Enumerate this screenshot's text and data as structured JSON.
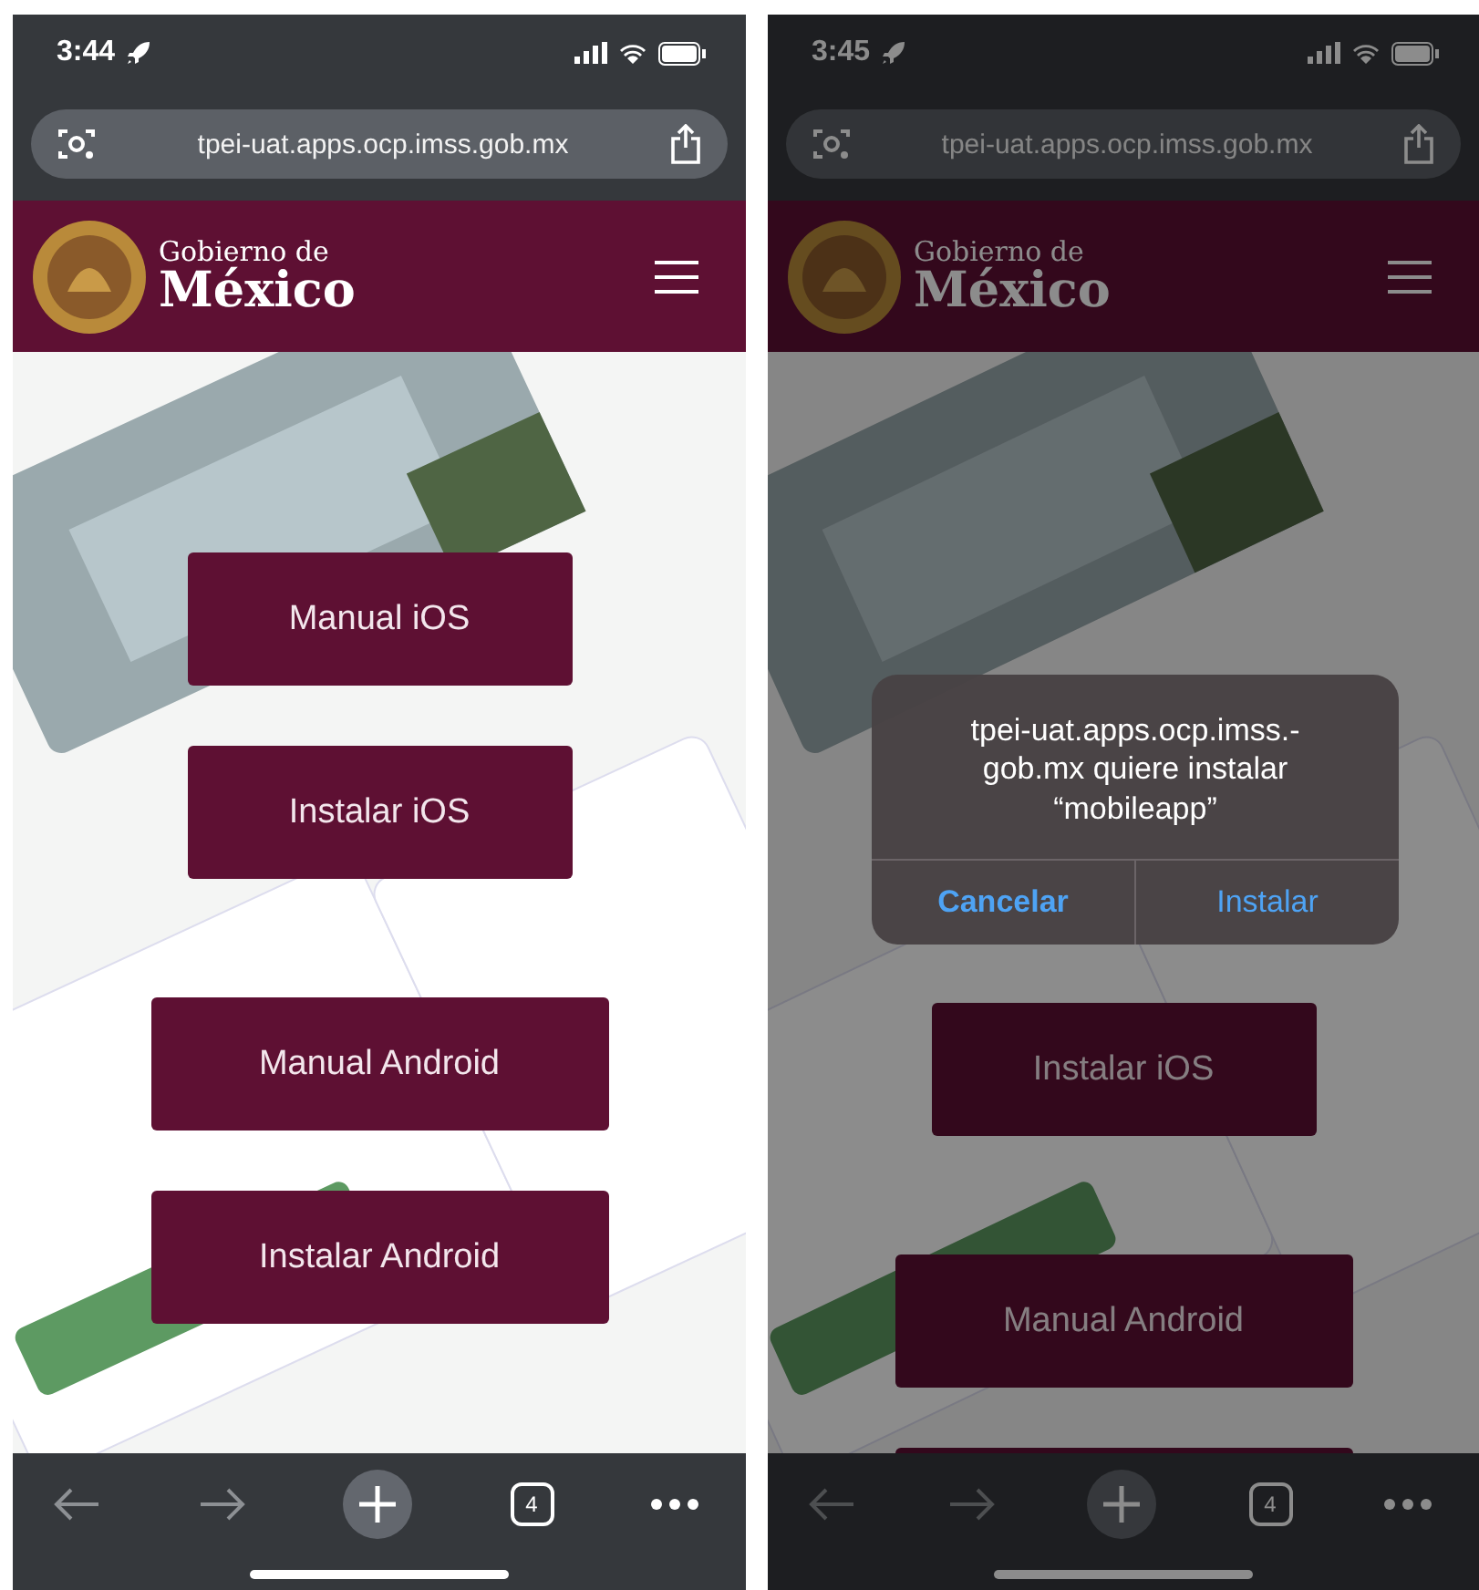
{
  "phones": [
    {
      "dimmed": false,
      "status_bar": {
        "time": "3:44"
      },
      "address_bar": {
        "url": "tpei-uat.apps.ocp.imss.gob.mx"
      },
      "header": {
        "line1": "Gobierno de",
        "line2": "México"
      },
      "buttons": [
        {
          "kind": "narrow",
          "label": "Manual iOS"
        },
        {
          "kind": "narrow",
          "label": "Instalar iOS"
        },
        {
          "kind": "wide",
          "label": "Manual Android"
        },
        {
          "kind": "wide",
          "label": "Instalar Android"
        }
      ],
      "toolbar": {
        "tab_count": "4"
      }
    },
    {
      "dimmed": true,
      "status_bar": {
        "time": "3:45"
      },
      "address_bar": {
        "url": "tpei-uat.apps.ocp.imss.gob.mx"
      },
      "header": {
        "line1": "Gobierno de",
        "line2": "México"
      },
      "buttons": [
        {
          "kind": "narrow",
          "label": "Instalar iOS"
        },
        {
          "kind": "wide",
          "label": "Manual Android"
        },
        {
          "kind": "cut"
        }
      ],
      "dialog": {
        "message": "tpei-uat.apps.ocp.imss.-gob.mx quiere instalar “mobileapp”",
        "actions": [
          {
            "label": "Cancelar",
            "bold": true
          },
          {
            "label": "Instalar",
            "bold": false
          }
        ]
      },
      "toolbar": {
        "tab_count": "4"
      }
    }
  ]
}
